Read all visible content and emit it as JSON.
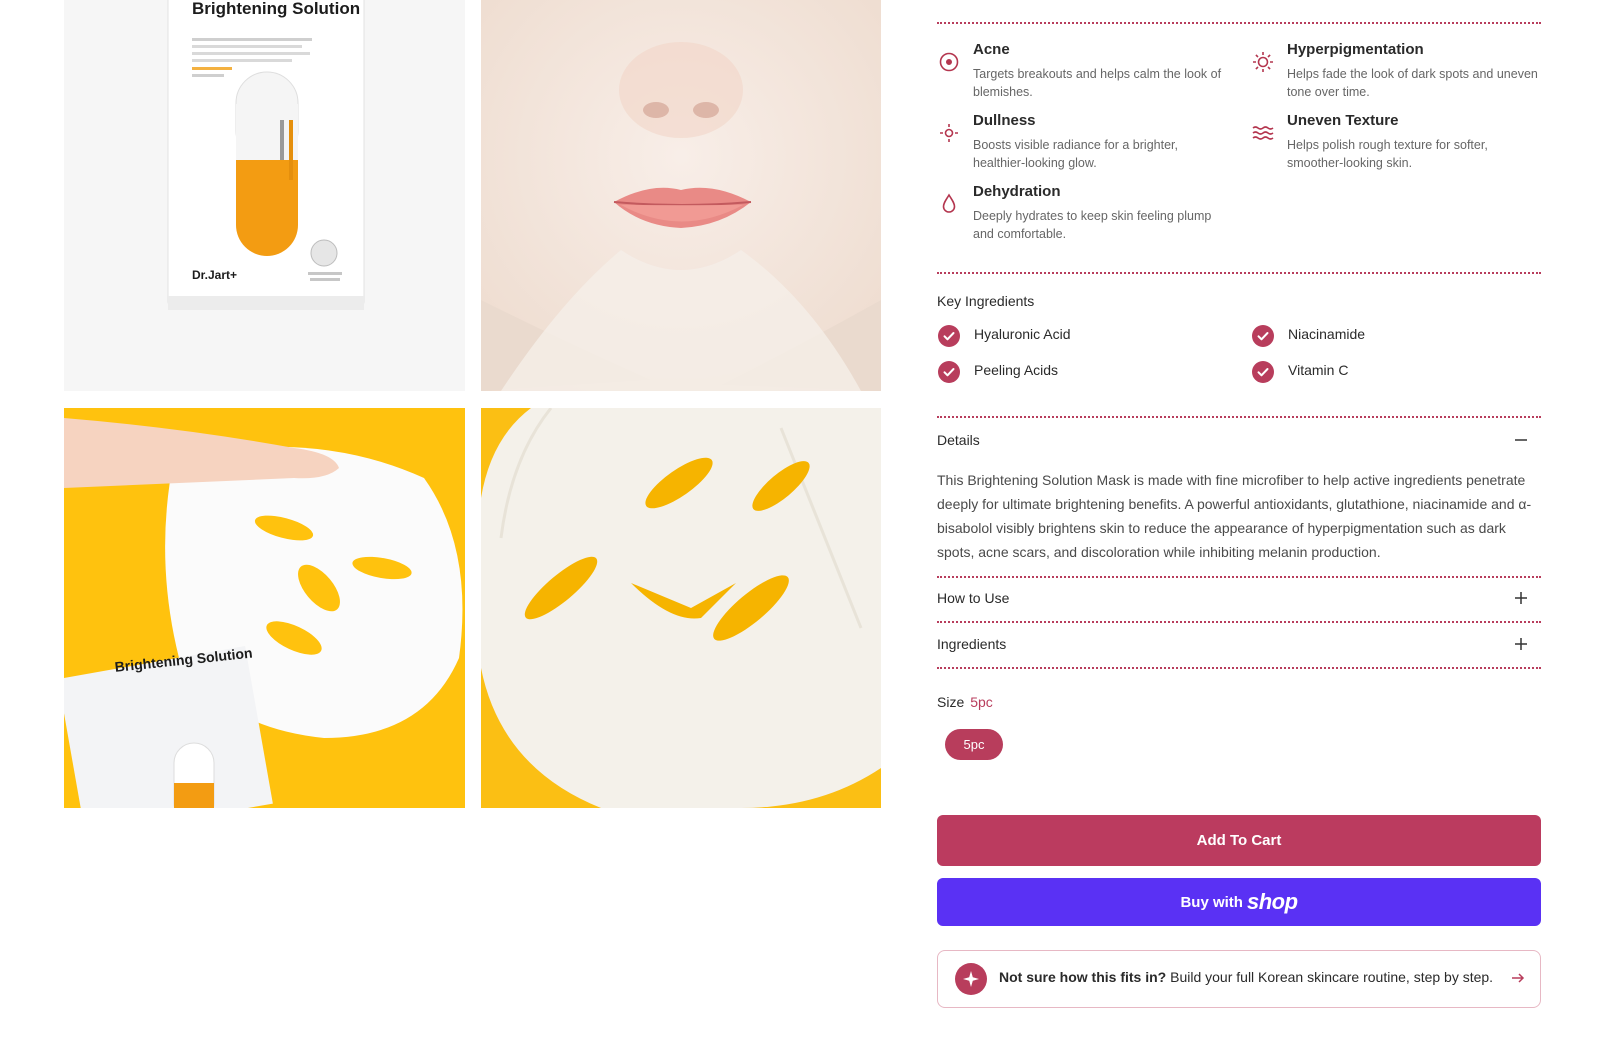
{
  "gallery": {
    "pack_title": "Brightening Solution",
    "pack_brand": "Dr.Jart+",
    "pack2_title": "Brightening Solution"
  },
  "concerns": [
    {
      "icon": "target-icon",
      "title": "Acne",
      "desc": "Targets breakouts and helps calm the look of blemishes."
    },
    {
      "icon": "sun-icon",
      "title": "Hyperpigmentation",
      "desc": "Helps fade the look of dark spots and uneven tone over time."
    },
    {
      "icon": "sparkle-sun-icon",
      "title": "Dullness",
      "desc": "Boosts visible radiance for a brighter, healthier-looking glow."
    },
    {
      "icon": "waves-icon",
      "title": "Uneven Texture",
      "desc": "Helps polish rough texture for softer, smoother-looking skin."
    },
    {
      "icon": "droplet-icon",
      "title": "Dehydration",
      "desc": "Deeply hydrates to keep skin feeling plump and comfortable."
    }
  ],
  "key_ingredients": {
    "label": "Key Ingredients",
    "items": [
      "Hyaluronic Acid",
      "Niacinamide",
      "Peeling Acids",
      "Vitamin C"
    ]
  },
  "accordion": {
    "details_label": "Details",
    "details_text": "This Brightening Solution Mask is made with fine microfiber to help active ingredients penetrate deeply for ultimate brightening benefits. A powerful antioxidants, glutathione, niacinamide and α-bisabolol visibly brightens skin to reduce the appearance of hyperpigmentation such as dark spots, acne scars, and discoloration while inhibiting melanin production.",
    "how_to_use_label": "How to Use",
    "ingredients_label": "Ingredients"
  },
  "size": {
    "label": "Size",
    "selected": "5pc",
    "options": [
      "5pc"
    ]
  },
  "buttons": {
    "add_to_cart": "Add To Cart",
    "buy_with": "Buy with",
    "shop_logo": "shop"
  },
  "routine": {
    "bold": "Not sure how this fits in?",
    "text": " Build your full Korean skincare routine, step by step."
  },
  "colors": {
    "accent": "#b83d5c",
    "shop_purple": "#5a31f4",
    "yellow": "#ffc20e"
  }
}
